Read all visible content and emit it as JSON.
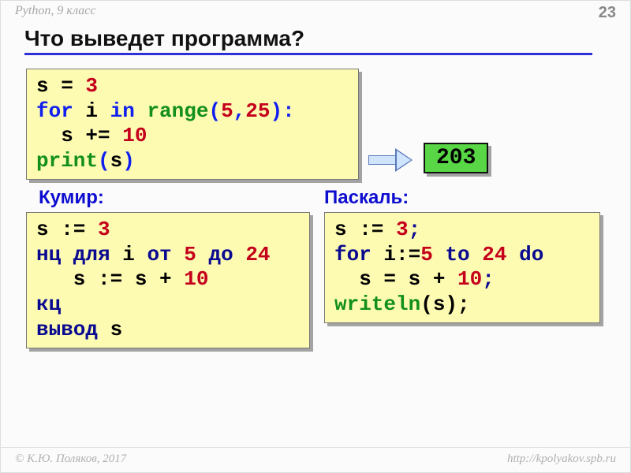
{
  "header": {
    "course": "Python, 9 класс",
    "page": "23"
  },
  "title": "Что выведет программа?",
  "labels": {
    "kumir": "Кумир:",
    "pascal": "Паскаль:"
  },
  "python": {
    "l1a": "s = ",
    "l1b": "3",
    "l2a": "for",
    "l2b": " i ",
    "l2c": "in",
    "l2d": " range",
    "l2e": "(",
    "l2f": "5",
    "l2g": ",",
    "l2h": "25",
    "l2i": "):",
    "l3a": "  s += ",
    "l3b": "10",
    "l4a": "print",
    "l4b": "(",
    "l4c": "s",
    "l4d": ")"
  },
  "kumir": {
    "l1a": "s := ",
    "l1b": "3",
    "l2a": "нц для",
    "l2b": " i ",
    "l2c": "от",
    "l2d": " ",
    "l2e": "5",
    "l2f": " ",
    "l2g": "до",
    "l2h": " ",
    "l2i": "24",
    "l3a": "   s := s + ",
    "l3b": "10",
    "l4": "кц",
    "l5a": "вывод",
    "l5b": " s"
  },
  "pascal": {
    "l1a": "s := ",
    "l1b": "3",
    "l1c": ";",
    "l2a": "for",
    "l2b": " i:=",
    "l2c": "5",
    "l2d": " ",
    "l2e": "to",
    "l2f": " ",
    "l2g": "24",
    "l2h": " ",
    "l2i": "do",
    "l3a": "  s = s + ",
    "l3b": "10",
    "l3c": ";",
    "l4a": "writeln",
    "l4b": "(s);"
  },
  "result": "203",
  "footer": {
    "copyright": "© К.Ю. Поляков, 2017",
    "url": "http://kpolyakov.spb.ru"
  }
}
